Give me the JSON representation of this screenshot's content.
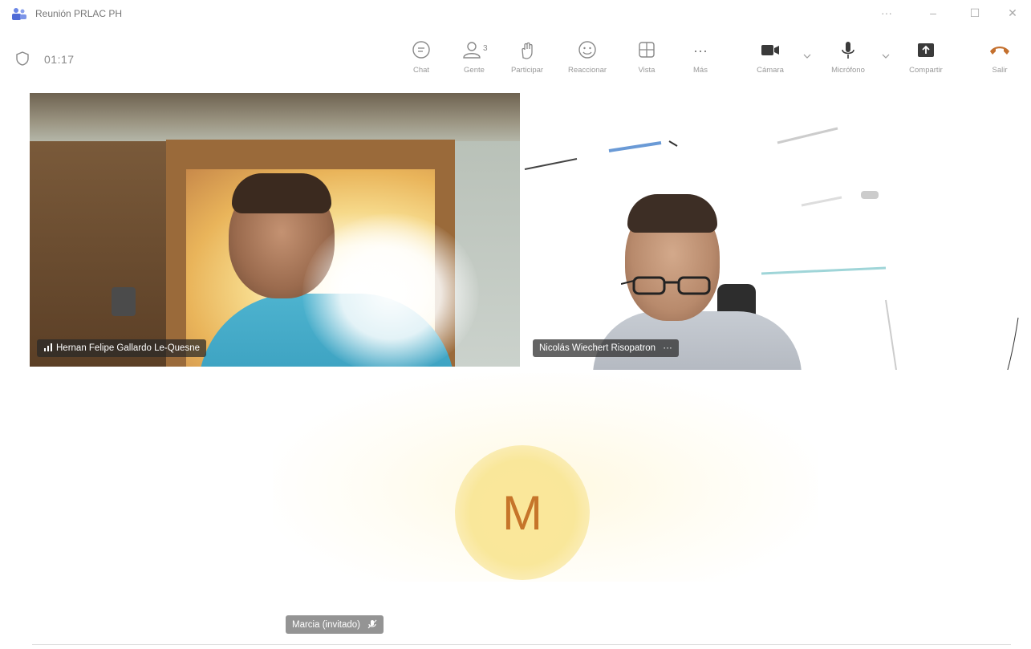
{
  "window": {
    "title": "Reunión PRLAC PH",
    "controls": [
      "···",
      "–",
      "☐",
      "✕"
    ]
  },
  "toolbar": {
    "timer": "01:17",
    "buttons": [
      {
        "label": "Chat",
        "icon": "chat-icon"
      },
      {
        "label": "Gente",
        "icon": "people-icon",
        "badge": "3"
      },
      {
        "label": "Participar",
        "icon": "raise-hand-icon"
      },
      {
        "label": "Reaccionar",
        "icon": "emoji-icon"
      },
      {
        "label": "Vista",
        "icon": "layout-icon"
      },
      {
        "label": "Más",
        "icon": "more-icon",
        "glyph": "···"
      },
      {
        "label": "Cámara",
        "icon": "camera-icon"
      },
      {
        "label": "Micrófono",
        "icon": "microphone-icon"
      },
      {
        "label": "Compartir",
        "icon": "share-icon"
      },
      {
        "label": "Salir",
        "icon": "hangup-icon"
      }
    ]
  },
  "participants": [
    {
      "name": "Hernan Felipe Gallardo Le-Quesne",
      "indicator": "signal-icon"
    },
    {
      "name": "Nicolás Wiechert Risopatron",
      "menu": "···"
    },
    {
      "name": "Marcia (invitado)",
      "initial": "M",
      "indicator": "muted-mic-icon"
    }
  ],
  "colors": {
    "hangup": "#c4702e",
    "avatar_bg": "#f9e79a",
    "avatar_text": "#c6752a",
    "app_icon": "#4f6bd6"
  }
}
